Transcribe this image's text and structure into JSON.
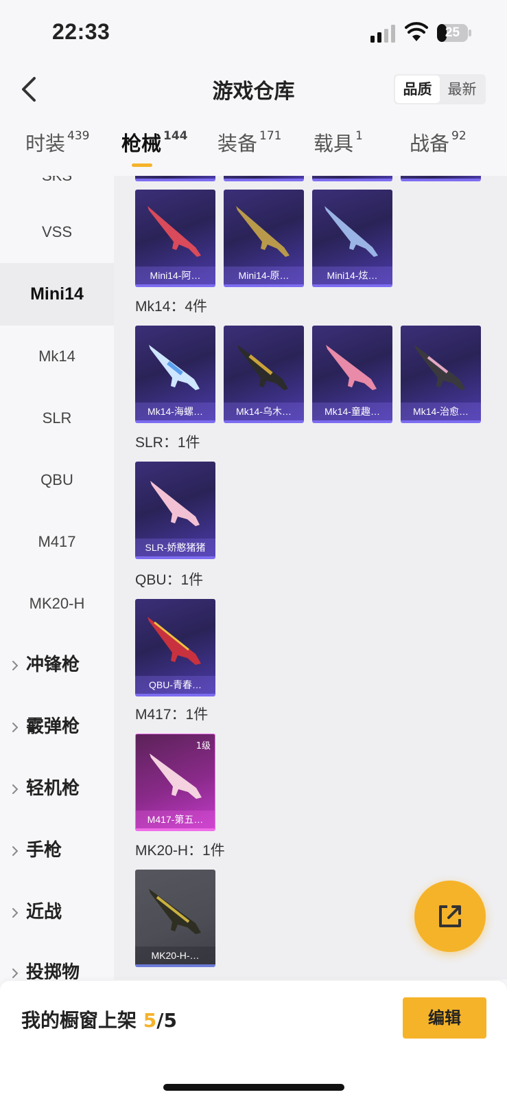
{
  "status_bar": {
    "time": "22:33",
    "battery": "25"
  },
  "header": {
    "title": "游戏仓库",
    "sort_quality": "品质",
    "sort_newest": "最新"
  },
  "tabs": [
    {
      "label": "时装",
      "count": "439"
    },
    {
      "label": "枪械",
      "count": "144"
    },
    {
      "label": "装备",
      "count": "171"
    },
    {
      "label": "载具",
      "count": "1"
    },
    {
      "label": "战备",
      "count": "92"
    }
  ],
  "sidebar": {
    "partial_top": "SKS",
    "items": [
      "VSS",
      "Mini14",
      "Mk14",
      "SLR",
      "QBU",
      "M417",
      "MK20-H"
    ],
    "groups": [
      "冲锋枪",
      "霰弹枪",
      "轻机枪",
      "手枪",
      "近战"
    ],
    "partial_bottom": "投掷物"
  },
  "content": {
    "mini14_cards": [
      "Mini14-阿…",
      "Mini14-原…",
      "Mini14-炫…"
    ],
    "mk14_title": "Mk14：4件",
    "mk14_cards": [
      "Mk14-海螺…",
      "Mk14-乌木…",
      "Mk14-童趣…",
      "Mk14-治愈…"
    ],
    "slr_title": "SLR：1件",
    "slr_cards": [
      "SLR-娇憨猪猪"
    ],
    "qbu_title": "QBU：1件",
    "qbu_cards": [
      "QBU-青春…"
    ],
    "m417_title": "M417：1件",
    "m417_cards": [
      {
        "label": "M417-第五…",
        "level": "1级"
      }
    ],
    "mk20_title": "MK20-H：1件",
    "mk20_cards": [
      "MK20-H-…"
    ]
  },
  "bottom_bar": {
    "shelf_label": "我的橱窗上架",
    "shelf_current": "5",
    "shelf_total": "/5",
    "edit_label": "编辑"
  },
  "colors": {
    "accent": "#f5b32a",
    "rare_purple": "#7c6cf0",
    "legend_pink": "#f06de8"
  },
  "icons": {
    "back": "chevron-left-icon",
    "share": "share-external-icon",
    "chevron": "chevron-right-icon"
  }
}
